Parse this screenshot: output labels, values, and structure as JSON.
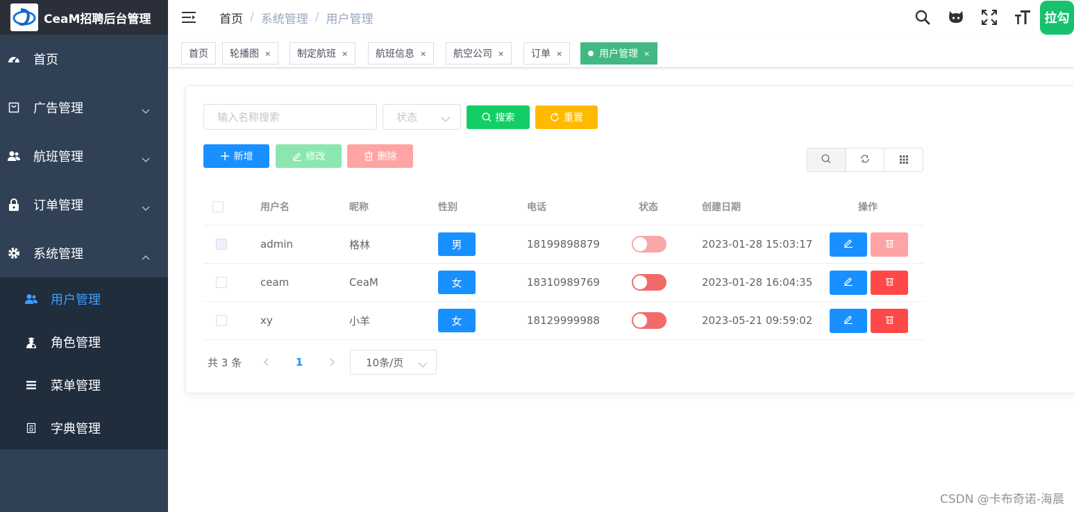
{
  "app": {
    "title": "CeaM招聘后台管理"
  },
  "sidebar": {
    "items": [
      {
        "label": "首页",
        "icon": "dashboard-icon"
      },
      {
        "label": "广告管理",
        "icon": "bag-icon"
      },
      {
        "label": "航班管理",
        "icon": "users-icon"
      },
      {
        "label": "订单管理",
        "icon": "lock-icon"
      },
      {
        "label": "系统管理",
        "icon": "gear-icon"
      }
    ],
    "sub_items": [
      {
        "label": "用户管理",
        "icon": "users-icon",
        "active": true
      },
      {
        "label": "角色管理",
        "icon": "role-icon"
      },
      {
        "label": "菜单管理",
        "icon": "list-icon"
      },
      {
        "label": "字典管理",
        "icon": "dict-icon"
      }
    ]
  },
  "navbar": {
    "breadcrumb": [
      "首页",
      "系统管理",
      "用户管理"
    ],
    "avatar_text": "拉勾"
  },
  "tags": [
    {
      "label": "首页"
    },
    {
      "label": "轮播图",
      "close": "×"
    },
    {
      "label": "制定航班",
      "close": "×"
    },
    {
      "label": "航班信息",
      "close": "×"
    },
    {
      "label": "航空公司",
      "close": "×"
    },
    {
      "label": "订单",
      "close": "×"
    },
    {
      "label": "用户管理",
      "close": "×",
      "active": true
    }
  ],
  "search": {
    "name_placeholder": "输入名称搜索",
    "status_placeholder": "状态",
    "search_label": "搜索",
    "reset_label": "重置"
  },
  "actions": {
    "add_label": "新增",
    "edit_label": "修改",
    "delete_label": "删除"
  },
  "table": {
    "columns": [
      "用户名",
      "昵称",
      "性别",
      "电话",
      "状态",
      "创建日期",
      "操作"
    ],
    "rows": [
      {
        "username": "admin",
        "nickname": "格林",
        "gender": "男",
        "phone": "18199898879",
        "enabled": false,
        "created": "2023-01-28 15:03:17",
        "deletable": false
      },
      {
        "username": "ceam",
        "nickname": "CeaM",
        "gender": "女",
        "phone": "18310989769",
        "enabled": false,
        "created": "2023-01-28 16:04:35",
        "deletable": true
      },
      {
        "username": "xy",
        "nickname": "小羊",
        "gender": "女",
        "phone": "18129999988",
        "enabled": false,
        "created": "2023-05-21 09:59:02",
        "deletable": true
      }
    ]
  },
  "pagination": {
    "total_text": "共 3 条",
    "current_page": "1",
    "page_size": "10条/页"
  },
  "watermark": "CSDN @卡布奇诺-海晨",
  "colors": {
    "sidebar_bg": "#304156",
    "submenu_bg": "#1f2d3d",
    "active_blue": "#409eff",
    "tag_active": "#42b983",
    "primary": "#1890ff",
    "success": "#13ce66",
    "warning": "#ffba00",
    "danger": "#ff4949",
    "switch_off": "#f36a6a"
  }
}
